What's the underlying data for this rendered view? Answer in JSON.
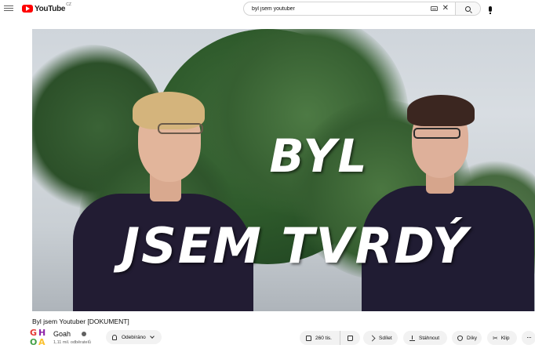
{
  "header": {
    "logo_text": "YouTube",
    "logo_country": "CZ",
    "search_value": "byl jsem youtuber"
  },
  "player": {
    "overlay_line1": "BYL",
    "overlay_line2": "JSEM TVRDÝ"
  },
  "video": {
    "title": "Byl jsem Youtuber [DOKUMENT]"
  },
  "channel": {
    "avatar_letters": [
      "G",
      "H",
      "O",
      "A"
    ],
    "name": "Goah",
    "subscribers": "1,11 mil. odběratelů",
    "subscribe_label": "Odebíráno"
  },
  "actions": {
    "likes": "260 tis.",
    "share": "Sdílet",
    "download": "Stáhnout",
    "thanks": "Díky",
    "clip": "Klip",
    "more": "···"
  },
  "icons": [
    "menu-icon",
    "youtube-logo-icon",
    "keyboard-icon",
    "clear-icon",
    "search-icon",
    "mic-icon",
    "verified-icon",
    "bell-icon",
    "chevron-down-icon",
    "thumb-up-icon",
    "thumb-down-icon",
    "share-icon",
    "download-icon",
    "thanks-icon",
    "scissors-icon",
    "more-icon"
  ],
  "colors": {
    "brand_red": "#ff0000",
    "pill_bg": "#f2f2f2",
    "text_primary": "#0f0f0f",
    "text_secondary": "#606060"
  }
}
